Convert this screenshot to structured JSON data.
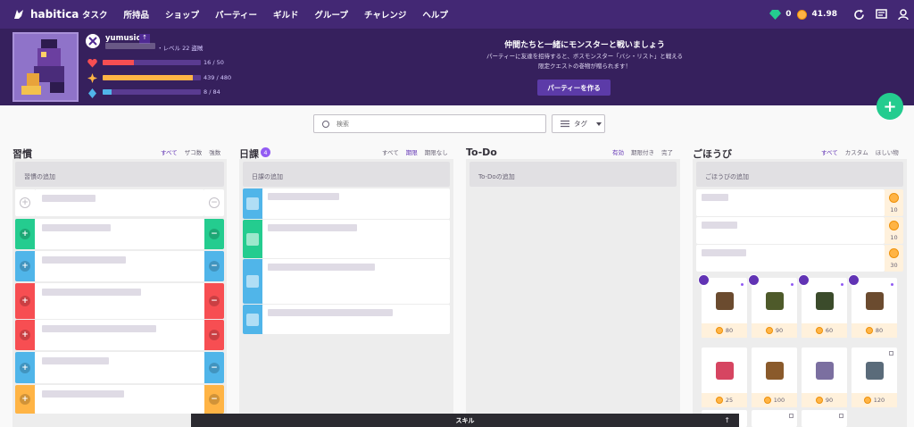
{
  "nav": {
    "brand": "habitica",
    "items": [
      "タスク",
      "所持品",
      "ショップ",
      "パーティー",
      "ギルド",
      "グループ",
      "チャレンジ",
      "ヘルプ"
    ],
    "gems": "0",
    "gold": "41.98"
  },
  "user": {
    "name": "yumusic",
    "level": "・レベル 22 盗賊",
    "hp": "16 / 50",
    "hp_frac": 0.32,
    "xp": "439 / 480",
    "xp_frac": 0.914,
    "mp": "8 / 84",
    "mp_frac": 0.095
  },
  "party": {
    "title": "仲間たちと一緒にモンスターと戦いましょう",
    "desc1": "パーティーに友達を招待すると、ボスモンスター「バシ・リスト」と戦える",
    "desc2": "限定クエストの巻物が贈られます！",
    "button": "パーティーを作る"
  },
  "search": {
    "placeholder": "検索"
  },
  "tags": {
    "label": "タグ"
  },
  "habits": {
    "title": "習慣",
    "filters": [
      "すべて",
      "ザコ数",
      "強数"
    ],
    "add": "習慣の追加"
  },
  "dailies": {
    "title": "日課",
    "badge": "4",
    "filters": [
      "すべて",
      "期限",
      "期限なし"
    ],
    "add": "日課の追加"
  },
  "todos": {
    "title": "To-Do",
    "filters": [
      "有効",
      "期限付き",
      "完了"
    ],
    "add": "To-Doの追加"
  },
  "rewards": {
    "title": "ごほうび",
    "filters": [
      "すべて",
      "カスタム",
      "ほしい物"
    ],
    "add": "ごほうびの追加",
    "custom_costs": [
      "10",
      "10",
      "30"
    ],
    "shop_costs": [
      "80",
      "90",
      "60",
      "80",
      "25",
      "100",
      "90",
      "120"
    ]
  },
  "skills": {
    "label": "スキル"
  },
  "colors": {
    "purple": "#432874",
    "green": "#24cc8f",
    "blue": "#50b5e9",
    "red": "#f74e52",
    "orange": "#ffb445"
  }
}
